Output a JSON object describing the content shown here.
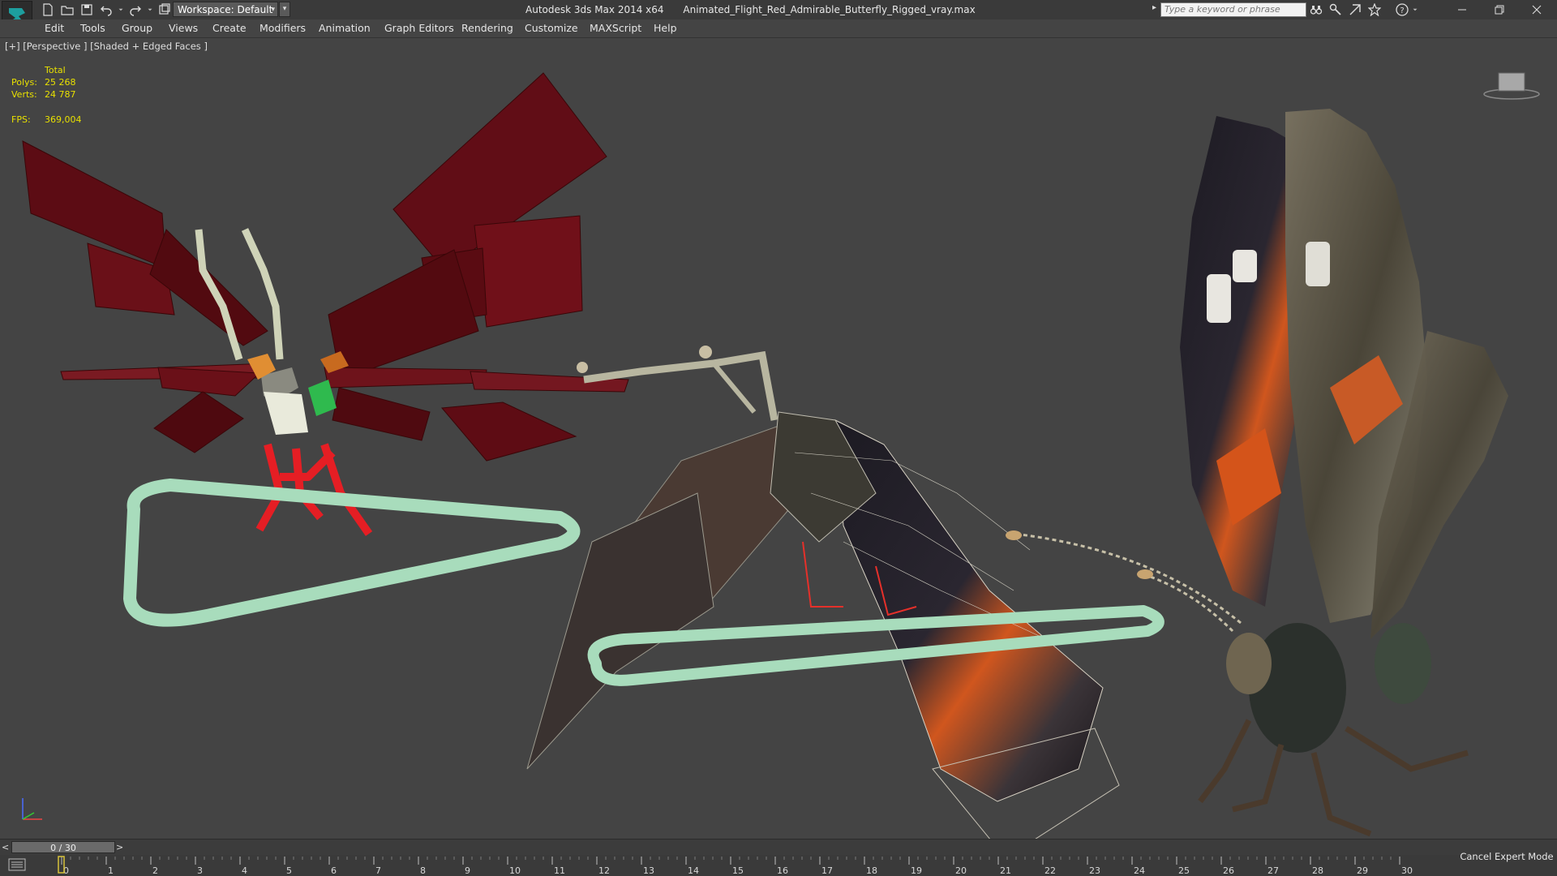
{
  "title_bar": {
    "workspace_label": "Workspace: Default",
    "app_title": "Autodesk 3ds Max  2014 x64",
    "file_name": "Animated_Flight_Red_Admirable_Butterfly_Rigged_vray.max",
    "search_placeholder": "Type a keyword or phrase",
    "quick_access_icons": [
      "new-file-icon",
      "open-folder-icon",
      "save-icon",
      "undo-icon",
      "redo-icon",
      "project-folder-icon"
    ],
    "right_icons": [
      "binoculars-icon",
      "key-search-icon",
      "exchange-icon",
      "favorite-star-icon",
      "help-icon"
    ]
  },
  "menu": {
    "items": [
      "Edit",
      "Tools",
      "Group",
      "Views",
      "Create",
      "Modifiers",
      "Animation",
      "Graph Editors",
      "Rendering",
      "Customize",
      "MAXScript",
      "Help"
    ]
  },
  "viewport": {
    "label": "[+] [Perspective ] [Shaded + Edged Faces ]",
    "stats": {
      "header": "Total",
      "polys_label": "Polys:",
      "polys_value": "25 268",
      "verts_label": "Verts:",
      "verts_value": "24 787",
      "fps_label": "FPS:",
      "fps_value": "369,004"
    },
    "stats_color": "#e8e000",
    "background_color": "#444444"
  },
  "time_slider": {
    "prev": "<",
    "value": "0 / 30",
    "next": ">"
  },
  "track_bar": {
    "ticks": [
      "0",
      "1",
      "2",
      "3",
      "4",
      "5",
      "6",
      "7",
      "8",
      "9",
      "10",
      "11",
      "12",
      "13",
      "14",
      "15",
      "16",
      "17",
      "18",
      "19",
      "20",
      "21",
      "22",
      "23",
      "24",
      "25",
      "26",
      "27",
      "28",
      "29",
      "30"
    ]
  },
  "expert_mode": {
    "label": "Cancel Expert Mode"
  }
}
